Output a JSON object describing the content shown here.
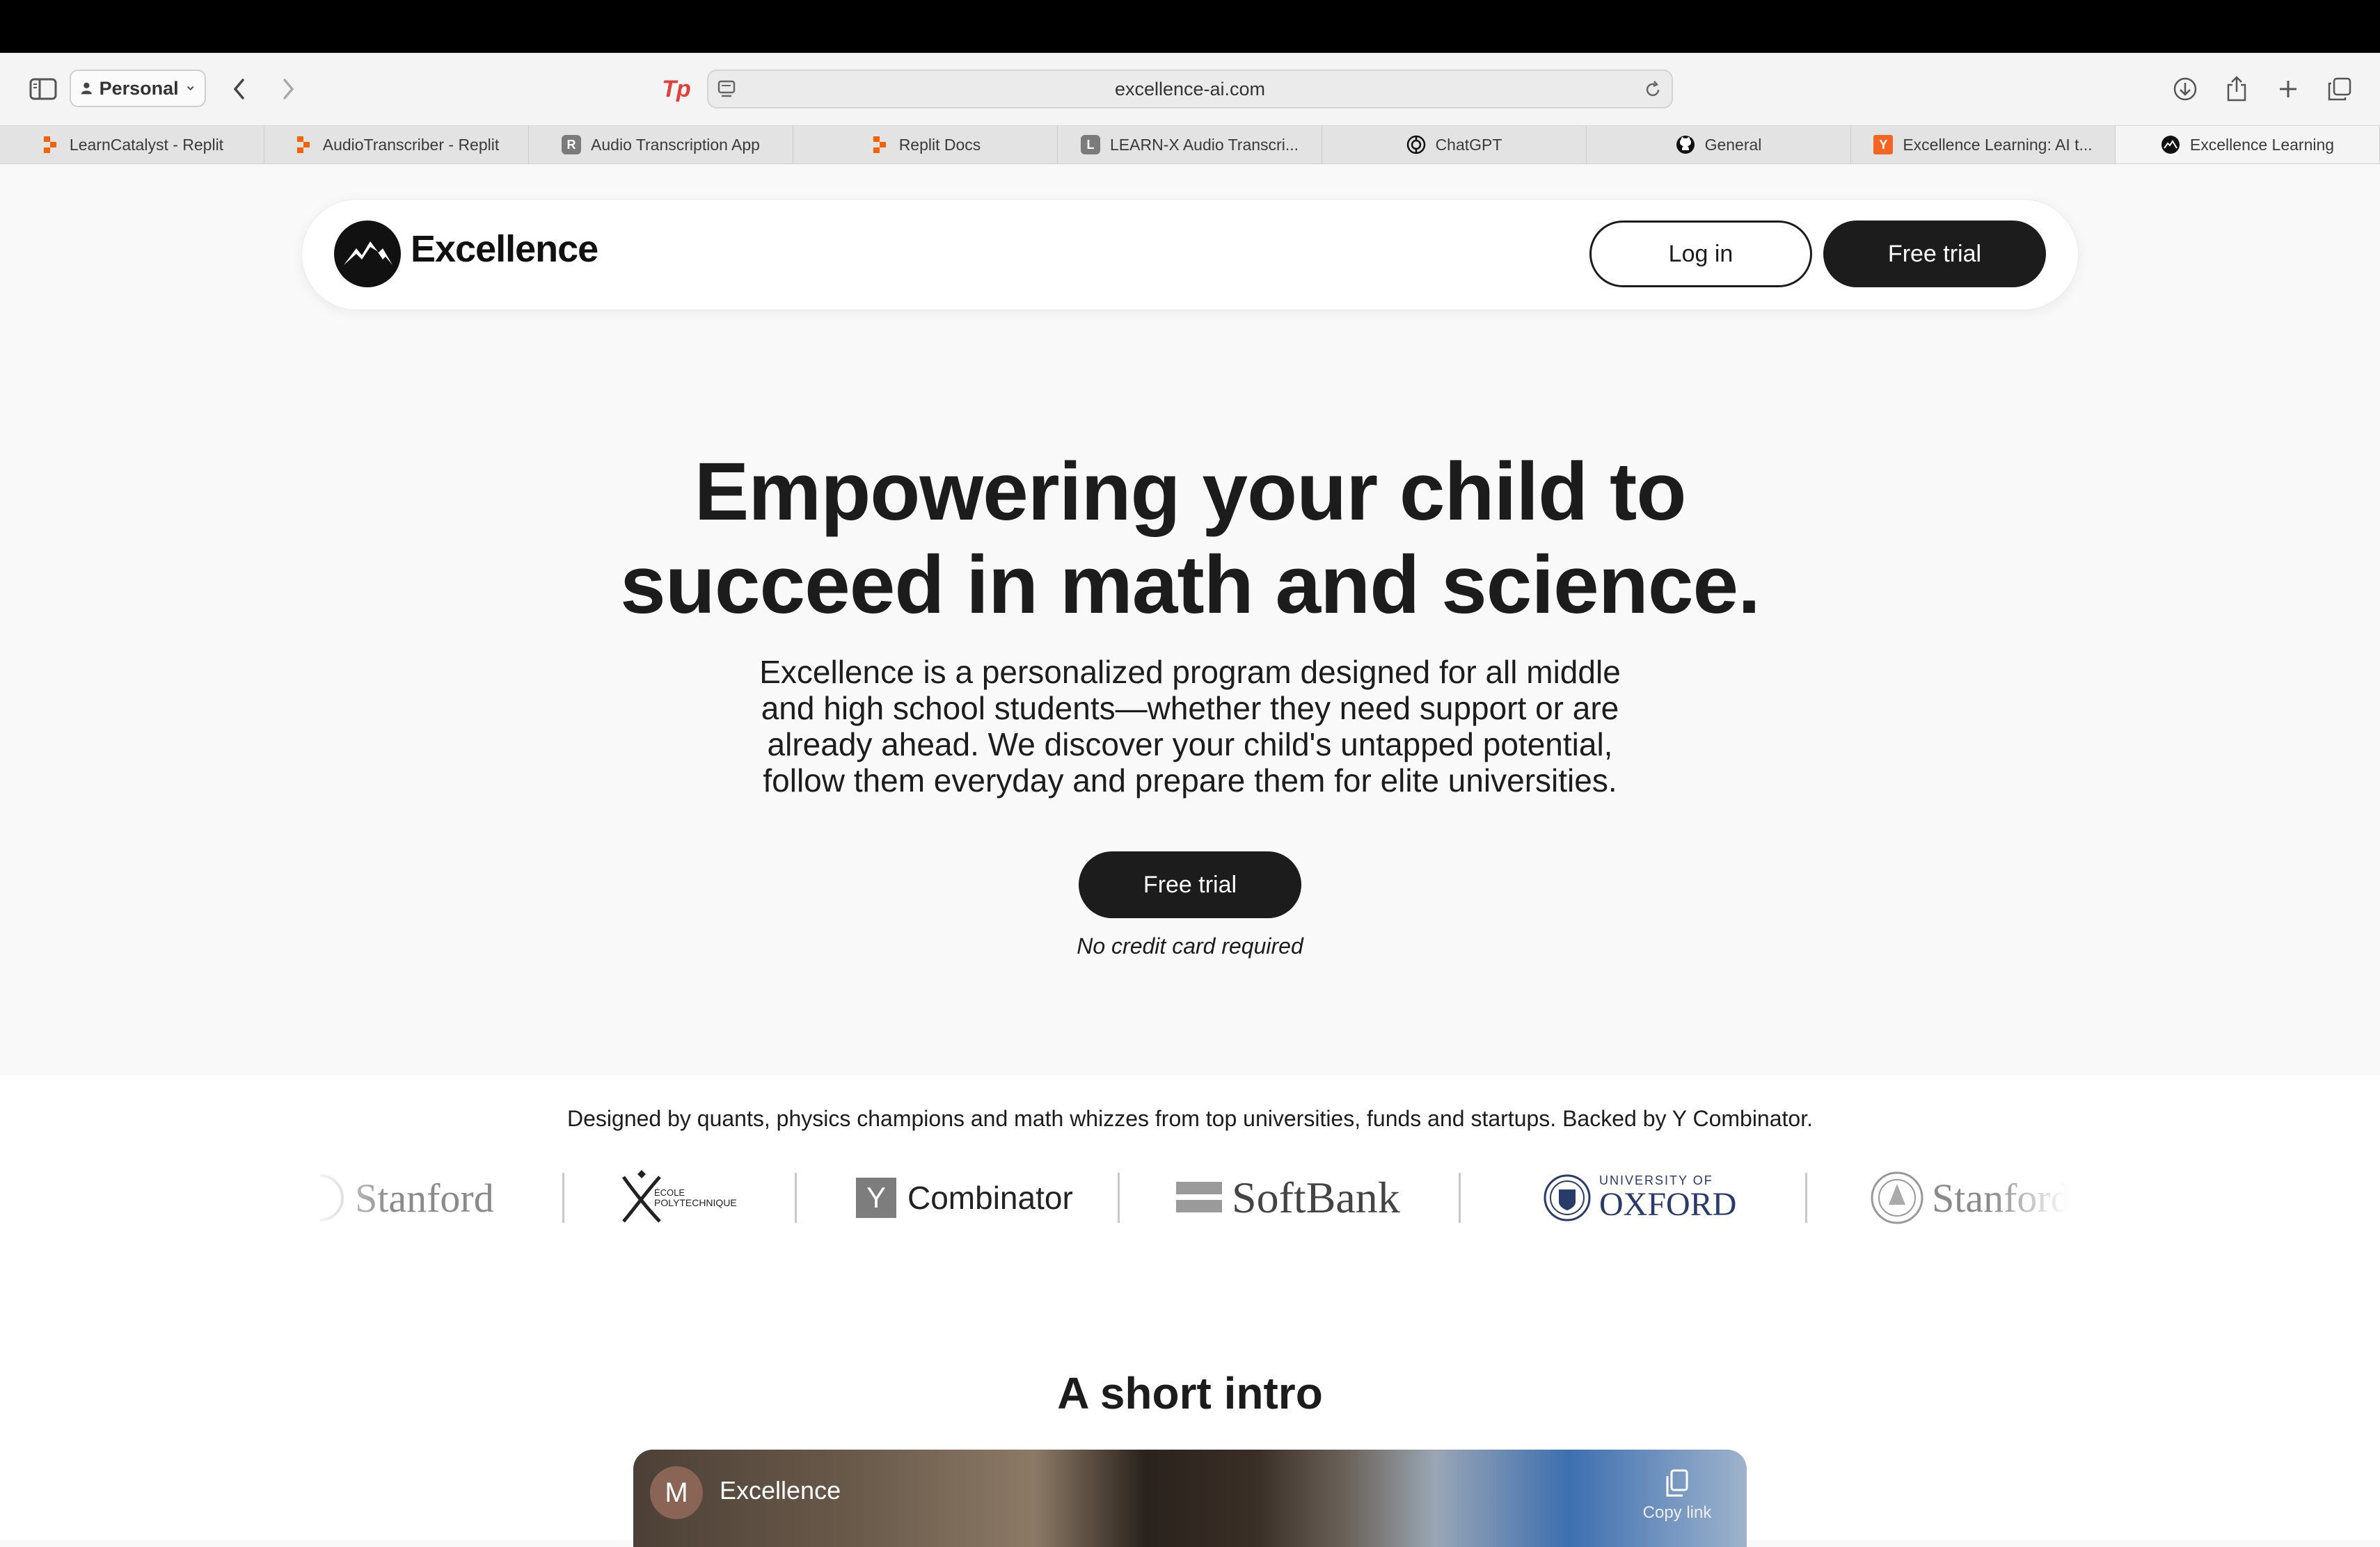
{
  "browser": {
    "profile_label": "Personal",
    "url": "excellence-ai.com",
    "tabs": [
      {
        "label": "LearnCatalyst - Replit",
        "icon": "replit-icon",
        "color": "#f26207"
      },
      {
        "label": "AudioTranscriber - Replit",
        "icon": "replit-icon",
        "color": "#f26207"
      },
      {
        "label": "Audio Transcription App",
        "icon": "letter-r-icon",
        "letter": "R",
        "color": "#7b7b7b"
      },
      {
        "label": "Replit Docs",
        "icon": "replit-icon",
        "color": "#f26207"
      },
      {
        "label": "LEARN-X Audio Transcri...",
        "icon": "letter-l-icon",
        "letter": "L",
        "color": "#7b7b7b"
      },
      {
        "label": "ChatGPT",
        "icon": "openai-icon",
        "color": "#111111"
      },
      {
        "label": "General",
        "icon": "github-icon",
        "color": "#111111"
      },
      {
        "label": "Excellence Learning: AI t...",
        "icon": "ycombinator-icon",
        "letter": "Y",
        "color": "#f26522"
      },
      {
        "label": "Excellence Learning",
        "icon": "excellence-icon",
        "color": "#111111"
      }
    ]
  },
  "header": {
    "brand": "Excellence",
    "login_label": "Log in",
    "trial_label": "Free trial"
  },
  "hero": {
    "title_line1": "Empowering your child to",
    "title_line2": "succeed in math and science.",
    "subtitle_line1": "Excellence is a personalized program designed for all middle",
    "subtitle_line2": "and high school students—whether they need support or are",
    "subtitle_line3": "already ahead. We discover your child's untapped potential,",
    "subtitle_line4": "follow them everyday and prepare them for elite universities.",
    "cta_label": "Free trial",
    "cta_note": "No credit card required"
  },
  "partners": {
    "tagline": "Designed by quants, physics champions and math whizzes from top universities, funds and startups. Backed by Y Combinator.",
    "logos": {
      "stanford": "Stanford",
      "polytechnique_top": "ÉCOLE",
      "polytechnique_bottom": "POLYTECHNIQUE",
      "yc_letter": "Y",
      "yc_name": "Combinator",
      "softbank": "SoftBank",
      "oxford_top": "UNIVERSITY OF",
      "oxford_bottom": "OXFORD",
      "stanford_2": "Stanford"
    }
  },
  "intro": {
    "title": "A short intro",
    "video_avatar_letter": "M",
    "video_title": "Excellence",
    "copy_link_label": "Copy link"
  }
}
